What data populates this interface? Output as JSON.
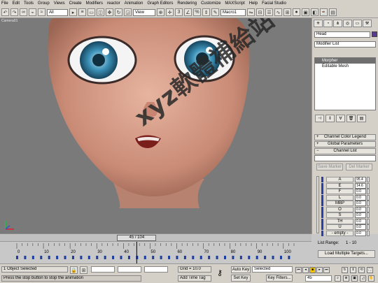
{
  "menu": [
    "File",
    "Edit",
    "Tools",
    "Group",
    "Views",
    "Create",
    "Modifiers",
    "reactor",
    "Animation",
    "Graph Editors",
    "Rendering",
    "Customize",
    "MAXScript",
    "Help",
    "Facial Studio"
  ],
  "toolbar": {
    "selection_filter": "All",
    "ref_coord": "View",
    "named_selection": "Macro1"
  },
  "viewport": {
    "label": "Camera01",
    "watermark": "xyz軟體補給站 31.to/xyz"
  },
  "command_panel": {
    "object_name": "Head",
    "modifier_list": "Modifier List",
    "stack_items": [
      "Morpher",
      "Editable Mesh"
    ],
    "selected_stack_index": 0,
    "rollouts": {
      "channel_color_legend": "Channel Color Legend",
      "global_parameters": "Global Parameters",
      "channel_list": "Channel List"
    },
    "save_marker": "Save Marker",
    "del_marker": "Del Marker",
    "channels": [
      {
        "name": "A",
        "value": "95.4"
      },
      {
        "name": "E",
        "value": "14.6"
      },
      {
        "name": "F",
        "value": "0.0"
      },
      {
        "name": "L",
        "value": "0.0"
      },
      {
        "name": "MBP",
        "value": "0.0"
      },
      {
        "name": "O",
        "value": "0.0"
      },
      {
        "name": "S",
        "value": "0.0"
      },
      {
        "name": "TH",
        "value": "0.0"
      },
      {
        "name": "U",
        "value": "0.0"
      },
      {
        "name": "- empty -",
        "value": "0.0"
      }
    ],
    "list_range": "List Range:",
    "list_range_value": "1 - 10",
    "load_multiple_targets": "Load Multiple Targets..."
  },
  "time_slider": {
    "label": "45 / 104",
    "frame": 45,
    "end": 104
  },
  "timeline": {
    "ticks": [
      "0",
      "10",
      "20",
      "30",
      "40",
      "50",
      "60",
      "70",
      "80",
      "90",
      "100"
    ]
  },
  "status": {
    "selection": "1 Object Selected",
    "prompt": "Press the stop button to stop the animation",
    "grid": "Grid = 10.0",
    "add_time_tag": "Add Time Tag",
    "auto_key": "Auto Key",
    "set_key": "Set Key",
    "key_mode": "Selected",
    "key_filters": "Key Filters...",
    "frame": "45"
  },
  "colors": {
    "viewport_bg": "#7a7a7a",
    "ui_bg": "#d4d0c8",
    "skin": "#d79b86",
    "iris": "#3a8fb5",
    "channel_bar": "#2b3fa8"
  }
}
